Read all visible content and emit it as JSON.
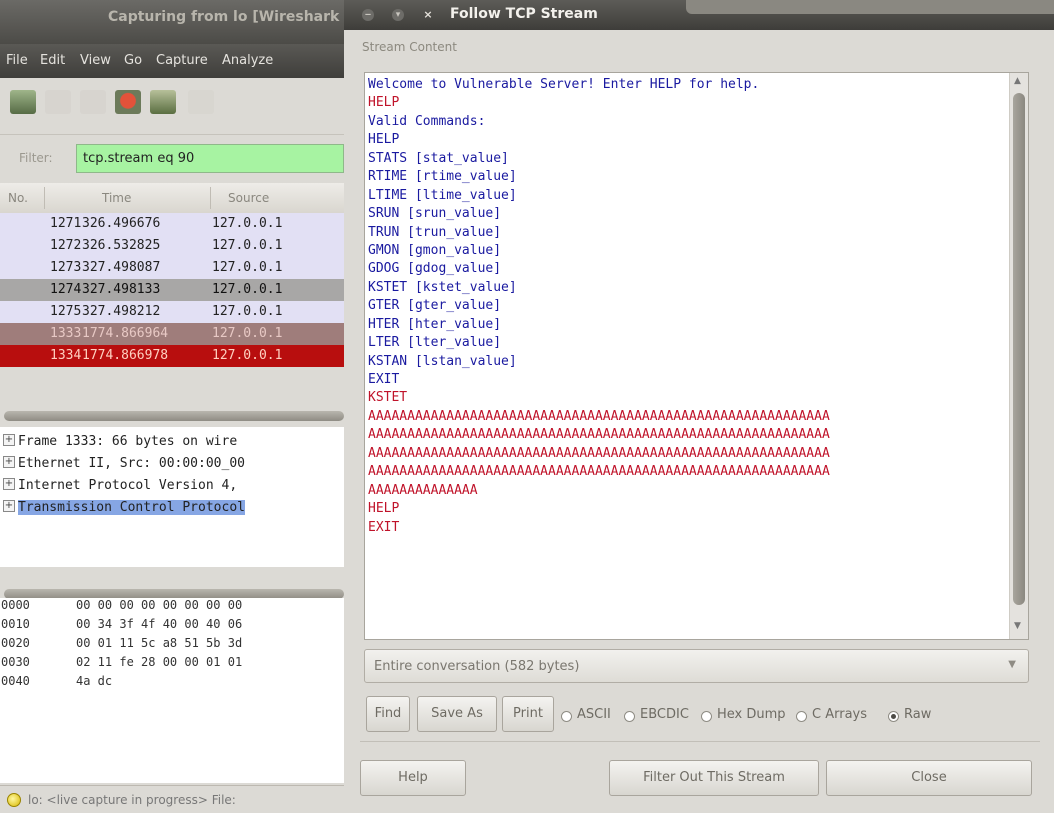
{
  "wireshark": {
    "window_title": "Capturing from lo   [Wireshark",
    "menu": [
      "File",
      "Edit",
      "View",
      "Go",
      "Capture",
      "Analyze"
    ],
    "filter": {
      "label": "Filter:",
      "value": "tcp.stream eq 90"
    },
    "columns": [
      "No.",
      "Time",
      "Source"
    ],
    "packets": [
      {
        "no": "1271",
        "time": "326.496676",
        "source": "127.0.0.1",
        "bg": "#e2e0f4",
        "fg": "#222222"
      },
      {
        "no": "1272",
        "time": "326.532825",
        "source": "127.0.0.1",
        "bg": "#e2e0f4",
        "fg": "#222222"
      },
      {
        "no": "1273",
        "time": "327.498087",
        "source": "127.0.0.1",
        "bg": "#e2e0f4",
        "fg": "#222222"
      },
      {
        "no": "1274",
        "time": "327.498133",
        "source": "127.0.0.1",
        "bg": "#a8a7a6",
        "fg": "#111111"
      },
      {
        "no": "1275",
        "time": "327.498212",
        "source": "127.0.0.1",
        "bg": "#e2e0f4",
        "fg": "#222222"
      },
      {
        "no": "1333",
        "time": "1774.866964",
        "source": "127.0.0.1",
        "bg": "#9f7d7b",
        "fg": "#e8c9c5"
      },
      {
        "no": "1334",
        "time": "1774.866978",
        "source": "127.0.0.1",
        "bg": "#b80e0e",
        "fg": "#ffd0c0"
      }
    ],
    "details": [
      "Frame 1333: 66 bytes on wire",
      "Ethernet II, Src: 00:00:00_00",
      "Internet Protocol Version 4,",
      "Transmission Control Protocol"
    ],
    "hex": [
      {
        "offset": "0000",
        "bytes": "00 00 00 00 00 00 00 00"
      },
      {
        "offset": "0010",
        "bytes": "00 34 3f 4f 40 00 40 06"
      },
      {
        "offset": "0020",
        "bytes": "00 01 11 5c a8 51 5b 3d"
      },
      {
        "offset": "0030",
        "bytes": "02 11 fe 28 00 00 01 01"
      },
      {
        "offset": "0040",
        "bytes": "4a dc"
      }
    ],
    "status": "lo: <live capture in progress> File:"
  },
  "dialog": {
    "title": "Follow TCP Stream",
    "frame_label": "Stream Content",
    "stream_lines": [
      {
        "text": "Welcome to Vulnerable Server! Enter HELP for help.",
        "dir": "server"
      },
      {
        "text": "HELP",
        "dir": "client"
      },
      {
        "text": "Valid Commands:",
        "dir": "server"
      },
      {
        "text": "HELP",
        "dir": "server"
      },
      {
        "text": "STATS [stat_value]",
        "dir": "server"
      },
      {
        "text": "RTIME [rtime_value]",
        "dir": "server"
      },
      {
        "text": "LTIME [ltime_value]",
        "dir": "server"
      },
      {
        "text": "SRUN [srun_value]",
        "dir": "server"
      },
      {
        "text": "TRUN [trun_value]",
        "dir": "server"
      },
      {
        "text": "GMON [gmon_value]",
        "dir": "server"
      },
      {
        "text": "GDOG [gdog_value]",
        "dir": "server"
      },
      {
        "text": "KSTET [kstet_value]",
        "dir": "server"
      },
      {
        "text": "GTER [gter_value]",
        "dir": "server"
      },
      {
        "text": "HTER [hter_value]",
        "dir": "server"
      },
      {
        "text": "LTER [lter_value]",
        "dir": "server"
      },
      {
        "text": "KSTAN [lstan_value]",
        "dir": "server"
      },
      {
        "text": "EXIT",
        "dir": "server"
      },
      {
        "text": "KSTET",
        "dir": "client"
      },
      {
        "text": "AAAAAAAAAAAAAAAAAAAAAAAAAAAAAAAAAAAAAAAAAAAAAAAAAAAAAAAAAAA",
        "dir": "client"
      },
      {
        "text": "AAAAAAAAAAAAAAAAAAAAAAAAAAAAAAAAAAAAAAAAAAAAAAAAAAAAAAAAAAA",
        "dir": "client"
      },
      {
        "text": "AAAAAAAAAAAAAAAAAAAAAAAAAAAAAAAAAAAAAAAAAAAAAAAAAAAAAAAAAAA",
        "dir": "client"
      },
      {
        "text": "AAAAAAAAAAAAAAAAAAAAAAAAAAAAAAAAAAAAAAAAAAAAAAAAAAAAAAAAAAA",
        "dir": "client"
      },
      {
        "text": "AAAAAAAAAAAAAA",
        "dir": "client"
      },
      {
        "text": "HELP",
        "dir": "client"
      },
      {
        "text": "EXIT",
        "dir": "client"
      }
    ],
    "conversation": "Entire conversation (582 bytes)",
    "find_label": "Find",
    "save_as_label": "Save As",
    "print_label": "Print",
    "formats": [
      {
        "label": "ASCII",
        "selected": false
      },
      {
        "label": "EBCDIC",
        "selected": false
      },
      {
        "label": "Hex Dump",
        "selected": false
      },
      {
        "label": "C Arrays",
        "selected": false
      },
      {
        "label": "Raw",
        "selected": true
      }
    ],
    "help_label": "Help",
    "filter_out_label": "Filter Out This Stream",
    "close_label": "Close"
  },
  "colors": {
    "server_text": "#1a1aa0",
    "client_text": "#c0132a"
  }
}
